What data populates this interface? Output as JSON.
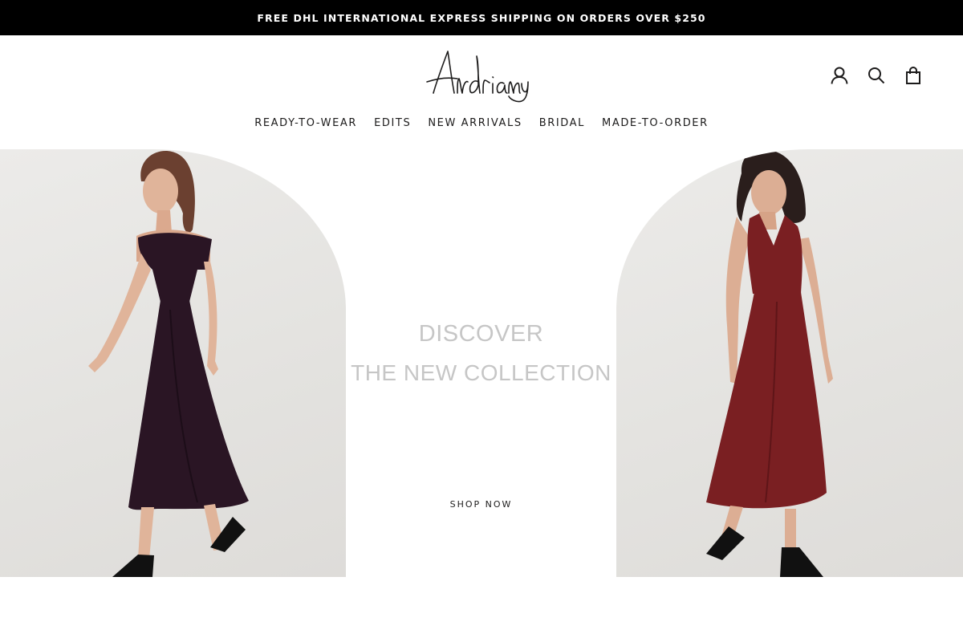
{
  "announcement": {
    "text": "FREE DHL INTERNATIONAL EXPRESS SHIPPING ON ORDERS OVER $250"
  },
  "header": {
    "logo_text": "Andriany",
    "icons": [
      "account-icon",
      "search-icon",
      "cart-icon"
    ]
  },
  "nav": {
    "items": [
      {
        "label": "READY-TO-WEAR"
      },
      {
        "label": "EDITS"
      },
      {
        "label": "NEW ARRIVALS"
      },
      {
        "label": "BRIDAL"
      },
      {
        "label": "MADE-TO-ORDER"
      }
    ]
  },
  "hero": {
    "line1": "DISCOVER",
    "line2": "THE NEW COLLECTION",
    "cta_label": "SHOP NOW"
  },
  "colors": {
    "announcement_bg": "#000000",
    "announcement_text": "#ffffff",
    "hero_text": "#c6c6c6",
    "text": "#1c1b1b",
    "dress_left": "#2a1524",
    "dress_right": "#7a1f22"
  }
}
